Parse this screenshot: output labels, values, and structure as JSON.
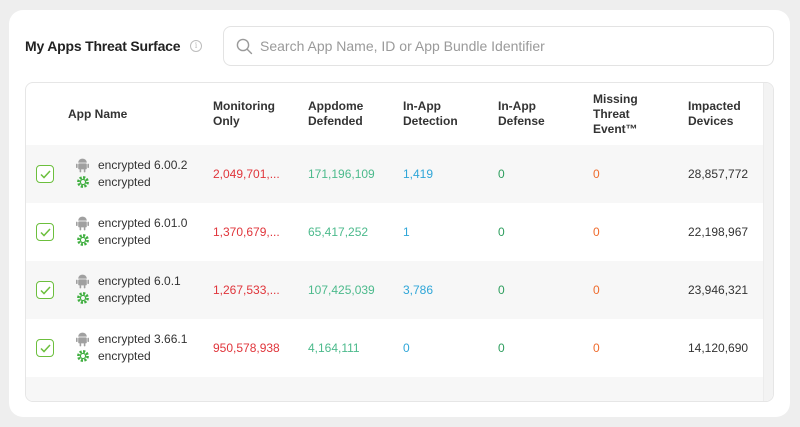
{
  "header": {
    "title": "My Apps Threat Surface",
    "info_glyph": "i"
  },
  "search": {
    "placeholder": "Search App Name, ID or App Bundle Identifier",
    "value": ""
  },
  "columns": {
    "app_name": "App Name",
    "monitoring": [
      "Monitoring",
      "Only"
    ],
    "defended": [
      "Appdome",
      "Defended"
    ],
    "detection": [
      "In-App",
      "Detection"
    ],
    "defense": [
      "In-App",
      "Defense"
    ],
    "missing": [
      "Missing",
      "Threat",
      "Event™"
    ],
    "impacted": [
      "Impacted",
      "Devices"
    ]
  },
  "rows": [
    {
      "app": "encrypted 6.00.2",
      "bundle": "encrypted",
      "monitoring": "2,049,701,...",
      "defended": "171,196,109",
      "detection": "1,419",
      "defense": "0",
      "missing": "0",
      "impacted": "28,857,772"
    },
    {
      "app": "encrypted 6.01.0",
      "bundle": "encrypted",
      "monitoring": "1,370,679,...",
      "defended": "65,417,252",
      "detection": "1",
      "defense": "0",
      "missing": "0",
      "impacted": "22,198,967"
    },
    {
      "app": "encrypted 6.0.1",
      "bundle": "encrypted",
      "monitoring": "1,267,533,...",
      "defended": "107,425,039",
      "detection": "3,786",
      "defense": "0",
      "missing": "0",
      "impacted": "23,946,321"
    },
    {
      "app": "encrypted 3.66.1",
      "bundle": "encrypted",
      "monitoring": "950,578,938",
      "defended": "4,164,111",
      "detection": "0",
      "defense": "0",
      "missing": "0",
      "impacted": "14,120,690"
    }
  ],
  "colors": {
    "monitoring": "#e0353b",
    "defended": "#4cba8c",
    "detection": "#2fa6d8",
    "defense": "#2e9e5e",
    "missing": "#ef6b2c",
    "checkbox": "#6cbf3d"
  },
  "icons": {
    "platform": "android-icon",
    "bundle": "settings-gear-icon",
    "search": "search-icon",
    "checkbox": "checkmark-icon"
  }
}
